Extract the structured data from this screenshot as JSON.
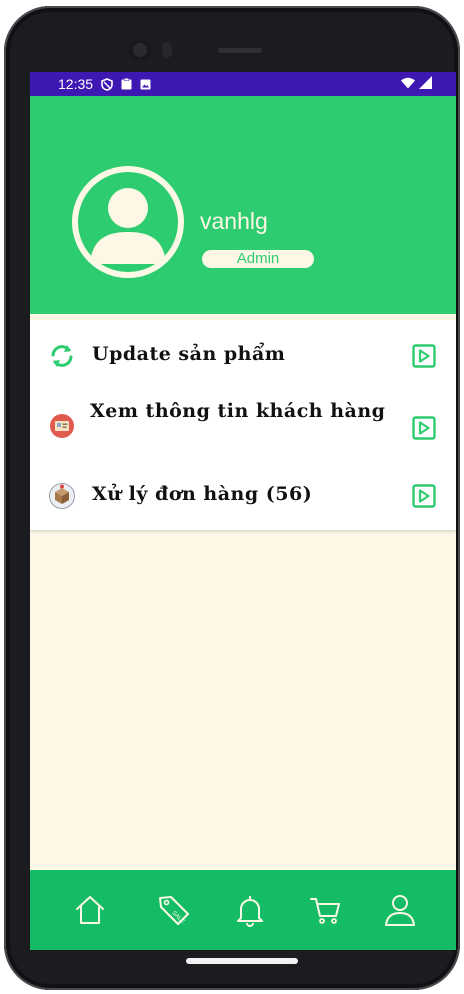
{
  "status_bar": {
    "time": "12:35",
    "left_icons": [
      "shield-icon",
      "clipboard-icon",
      "image-icon"
    ],
    "right_icons": [
      "wifi-icon",
      "signal-icon"
    ]
  },
  "profile": {
    "username": "vanhlg",
    "role": "Admin",
    "avatar_icon": "user-avatar-icon"
  },
  "menu": [
    {
      "label": "Update sản phẩm",
      "icon": "refresh-icon"
    },
    {
      "label": "Xem thông tin khách hàng",
      "icon": "customer-card-icon"
    },
    {
      "label": "Xử lý đơn hàng (56)",
      "icon": "package-icon"
    }
  ],
  "bottom_nav": [
    "home-icon",
    "sale-tag-icon",
    "bell-icon",
    "cart-icon",
    "profile-icon"
  ],
  "colors": {
    "primary_green": "#2ecc71",
    "nav_green": "#14bc66",
    "status_bar": "#3f17b2",
    "background_cream": "#fdf8e5"
  }
}
